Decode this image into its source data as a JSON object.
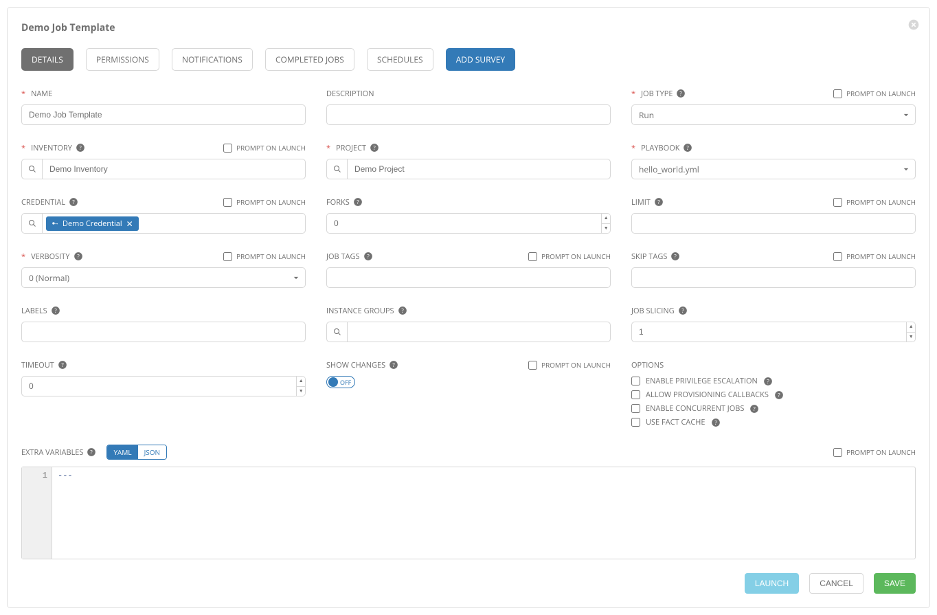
{
  "header": {
    "title": "Demo Job Template"
  },
  "tabs": {
    "details": "DETAILS",
    "permissions": "PERMISSIONS",
    "notifications": "NOTIFICATIONS",
    "completed": "COMPLETED JOBS",
    "schedules": "SCHEDULES",
    "survey": "ADD SURVEY"
  },
  "labels": {
    "name": "NAME",
    "description": "DESCRIPTION",
    "job_type": "JOB TYPE",
    "inventory": "INVENTORY",
    "project": "PROJECT",
    "playbook": "PLAYBOOK",
    "credential": "CREDENTIAL",
    "forks": "FORKS",
    "limit": "LIMIT",
    "verbosity": "VERBOSITY",
    "job_tags": "JOB TAGS",
    "skip_tags": "SKIP TAGS",
    "labels_f": "LABELS",
    "instance_groups": "INSTANCE GROUPS",
    "job_slicing": "JOB SLICING",
    "timeout": "TIMEOUT",
    "show_changes": "SHOW CHANGES",
    "options": "OPTIONS",
    "extra_vars": "EXTRA VARIABLES",
    "prompt": "PROMPT ON LAUNCH"
  },
  "values": {
    "name": "Demo Job Template",
    "description": "",
    "job_type": "Run",
    "inventory": "Demo Inventory",
    "project": "Demo Project",
    "playbook": "hello_world.yml",
    "credential": "Demo Credential",
    "forks": "0",
    "limit": "",
    "verbosity": "0 (Normal)",
    "job_tags": "",
    "skip_tags": "",
    "labels_f": "",
    "instance_groups": "",
    "job_slicing": "1",
    "timeout": "0",
    "show_changes": "OFF",
    "extra_vars_content": "---"
  },
  "options": {
    "priv_esc": "ENABLE PRIVILEGE ESCALATION",
    "callbacks": "ALLOW PROVISIONING CALLBACKS",
    "concurrent": "ENABLE CONCURRENT JOBS",
    "fact_cache": "USE FACT CACHE"
  },
  "code": {
    "yaml": "YAML",
    "json": "JSON",
    "line_no": "1"
  },
  "buttons": {
    "launch": "LAUNCH",
    "cancel": "CANCEL",
    "save": "SAVE"
  }
}
